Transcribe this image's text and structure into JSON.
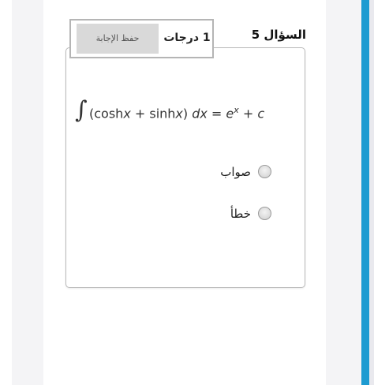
{
  "question": {
    "number_label": "السؤال 5",
    "points_label": "1 درجات",
    "save_button_label": "حفظ الإجابة"
  },
  "formula": {
    "integrand_prefix": "(cosh",
    "x1": "x",
    "plus1": " + sinh",
    "x2": "x",
    "suffix": ") ",
    "dx": "dx",
    "equals": " = ",
    "e": "e",
    "sup": "x",
    "tail": " + ",
    "c": "c"
  },
  "options": [
    {
      "label": "صواب"
    },
    {
      "label": "خطأ"
    }
  ],
  "colors": {
    "scroll_rail": "#1d9bd1",
    "save_button_bg": "#d9d9d9",
    "side_panels": "#f4f4f6"
  }
}
